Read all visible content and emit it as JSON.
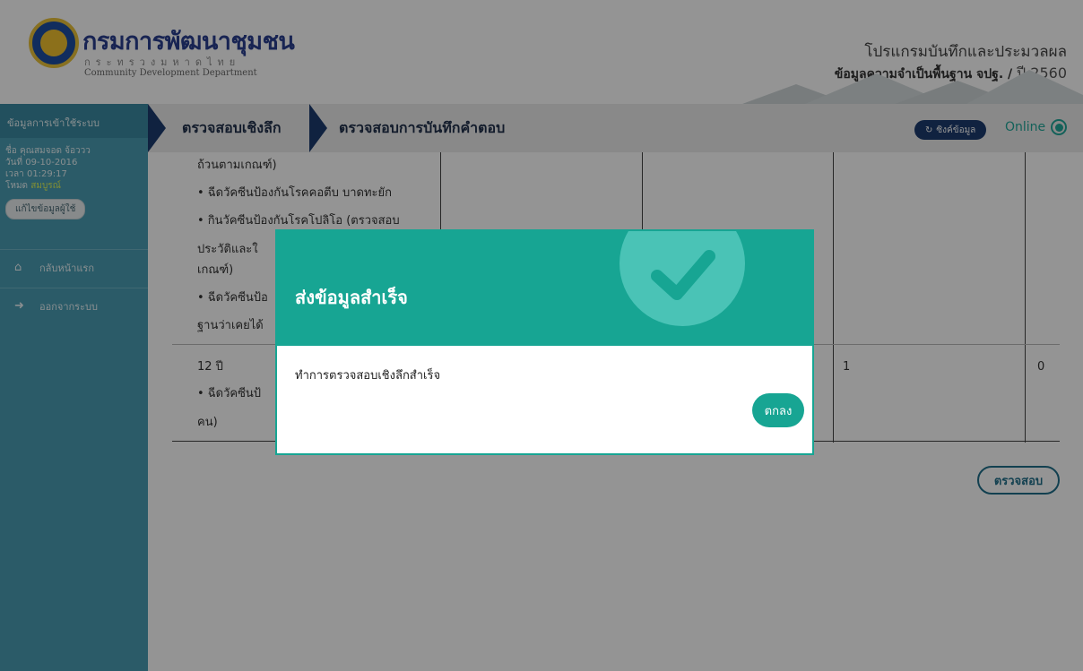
{
  "header": {
    "brand_title": "กรมการพัฒนาชุมชน",
    "brand_subtitle": "กระทรวงมหาดไทย",
    "brand_english": "Community Development Department",
    "program_title": "โปรแกรมบันทึกและประมวลผล",
    "program_subtitle": "ข้อมูลความจำเป็นพื้นฐาน จปฐ. /",
    "program_year": "ปี 2560"
  },
  "sidebar": {
    "login_label": "ข้อมูลการเข้าใช้ระบบ",
    "user_name": "ชื่อ คุณสมจอด จ้อววว",
    "date": "วันที่ 09-10-2016",
    "time": "เวลา 01:29:17",
    "mode_label": "โหมด",
    "mode_value": "สมบูรณ์",
    "edit_button": "แก้ไขข้อมูลผู้ใช้",
    "nav": [
      {
        "label": "กลับหน้าแรก",
        "icon": "home-icon"
      },
      {
        "label": "ออกจากระบบ",
        "icon": "logout-icon"
      }
    ]
  },
  "topnav": {
    "crumbs": [
      "ตรวจสอบเชิงลึก",
      "ตรวจสอบการบันทึกคำตอบ"
    ],
    "sync_button": "ซิงค์ข้อมูล",
    "online_label": "Online"
  },
  "table": {
    "lines_top": [
      "ถ้วนตามเกณฑ์)",
      "• ฉีดวัคซีนป้องกันโรคคอตีบ บาดทะยัก",
      "• กินวัคซีนป้องกันโรคโปลิโอ (ตรวจสอบ",
      "ประวัติและใ",
      "เกณฑ์)",
      "• ฉีดวัคซีนป้อ",
      "ฐานว่าเคยได้"
    ],
    "lines_bottom": [
      "12 ปี",
      "• ฉีดวัคซีนป้",
      "คน)"
    ],
    "col3_value": "1",
    "col4_value": "0"
  },
  "check_button": "ตรวจสอบ",
  "modal": {
    "title": "ส่งข้อมูลสำเร็จ",
    "message": "ทำการตรวจสอบเชิงลึกสำเร็จ",
    "ok_button": "ตกลง"
  },
  "colors": {
    "teal": "#17a593",
    "navy": "#1c3b6e",
    "sidebar": "#4a9db3"
  }
}
